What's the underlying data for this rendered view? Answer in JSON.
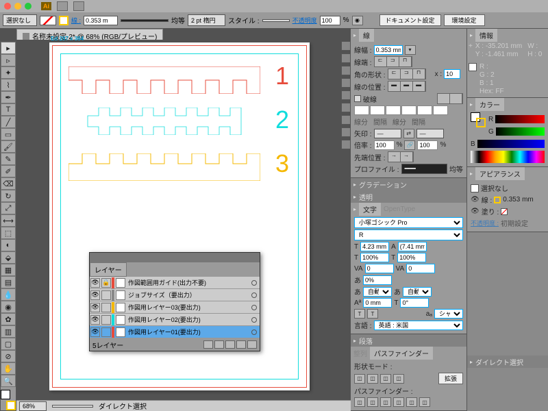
{
  "menubar": {
    "app": "Ai"
  },
  "controlbar": {
    "selection": "選択なし",
    "stroke_weight": "0.353 m",
    "uniform": "均等",
    "brush": "2 pt 楕円",
    "style_label": "スタイル :",
    "opacity_label": "不透明度",
    "opacity": "100",
    "pct": "%",
    "doc_setup": "ドキュメント設定",
    "prefs": "環境設定"
  },
  "doc": {
    "title": "名称未設定-2* @ 68% (RGB/プレビュー)",
    "artboard_label": "Ed   297 x 364",
    "nums": {
      "n1": "1",
      "n2": "2",
      "n3": "3"
    }
  },
  "status": {
    "zoom": "68%",
    "tool": "ダイレクト選択"
  },
  "layers": {
    "title": "レイヤー",
    "items": [
      {
        "name": "作図範囲用ガイド(出力不要)",
        "color": "#e74c3c"
      },
      {
        "name": "ジョブサイズ（要出力）",
        "color": "#888"
      },
      {
        "name": "作図用レイヤー03(要出力)",
        "color": "#f5b800"
      },
      {
        "name": "作図用レイヤー02(要出力)",
        "color": "#1dd"
      },
      {
        "name": "作図用レイヤー01(要出力)",
        "color": "#e74c3c"
      }
    ],
    "count": "5レイヤー"
  },
  "stroke": {
    "title": "線",
    "weight_label": "線幅 :",
    "weight": "0.353 mm",
    "cap_label": "線端 :",
    "corner_label": "角の形状 :",
    "miter_label": "x :",
    "miter": "10",
    "align_label": "線の位置 :",
    "dash_label": "破線",
    "dash_sub1": "線分",
    "dash_sub2": "間隔",
    "arrow_label": "矢印 :",
    "scale_label": "倍率 :",
    "scale1": "100",
    "scale2": "100",
    "arrowpos_label": "先端位置 :",
    "profile_label": "プロファイル :",
    "profile": "均等"
  },
  "gradient": {
    "title": "グラデーション"
  },
  "transparency": {
    "title": "透明"
  },
  "char": {
    "tab1": "文字",
    "tab2": "OpenType",
    "font": "小塚ゴシック Pro",
    "weight": "R",
    "size": "4.23 mm",
    "leading": "(7.41 mm)",
    "vscale": "100%",
    "hscale": "100%",
    "kerning": "0",
    "tracking": "0",
    "baseline": "0%",
    "auto": "自動",
    "shift": "0 mm",
    "aa": "シャープ",
    "lang_label": "言語 :",
    "lang": "英語 : 米国"
  },
  "para": {
    "title": "段落"
  },
  "pathfinder": {
    "tab1": "整列",
    "tab2": "パスファインダー",
    "shape_mode": "形状モード :",
    "pf_label": "パスファインダー :",
    "expand": "拡張"
  },
  "info": {
    "title": "情報",
    "x": "X :  -35.201 mm",
    "y": "Y :   -1.461 mm",
    "w": "W :",
    "h": "H :  0",
    "r": "R :",
    "g": "G :  2",
    "b": "B :  1",
    "hex": "Hex: FF"
  },
  "color": {
    "title": "カラー",
    "r": "R",
    "g": "G",
    "b": "B"
  },
  "appearance": {
    "title": "アピアランス",
    "no_sel": "選択なし",
    "stroke": "線 :",
    "stroke_val": "0.353 mm",
    "fill": "塗り :",
    "opacity": "不透明度 :",
    "opacity_val": "初期設定"
  },
  "direct": {
    "title": "ダイレクト選択"
  }
}
